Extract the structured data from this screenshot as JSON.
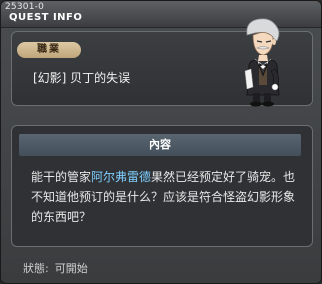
{
  "window": {
    "quest_id": "25301-0",
    "title": "QUEST INFO"
  },
  "quest": {
    "job_label": "職業",
    "name": "[幻影] 贝丁的失误"
  },
  "content": {
    "header": "內容",
    "text_before": "能干的管家",
    "npc_name": "阿尔弗雷德",
    "text_after": "果然已经预定好了骑宠。也不知道他预订的是什么？应该是符合怪盗幻影形象的东西吧？"
  },
  "status": {
    "label": "狀態:",
    "value": "可開始"
  },
  "colors": {
    "npc_highlight": "#7fcfff",
    "job_badge": "#cdb68e"
  },
  "icons": {
    "portrait": "butler-npc-portrait"
  }
}
